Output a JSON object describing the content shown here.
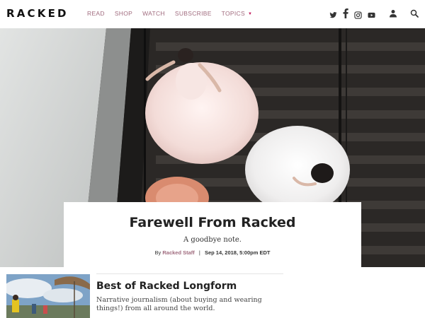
{
  "header": {
    "logo": "RACKED",
    "nav": [
      {
        "label": "READ"
      },
      {
        "label": "SHOP"
      },
      {
        "label": "WATCH"
      },
      {
        "label": "SUBSCRIBE"
      },
      {
        "label": "TOPICS"
      }
    ],
    "social_icons": [
      "twitter-icon",
      "facebook-icon",
      "instagram-icon",
      "youtube-icon"
    ],
    "utility_icons": [
      "user-icon",
      "search-icon"
    ]
  },
  "hero": {
    "image": "overhead-view-of-women-in-ball-gowns-on-stairs"
  },
  "feature": {
    "title": "Farewell From Racked",
    "dek": "A goodbye note.",
    "by": "By",
    "author": "Racked Staff",
    "separator": "|",
    "date": "Sep 14, 2018, 5:00pm EDT"
  },
  "teaser": {
    "image": "umbrella-beach-photo",
    "title": "Best of Racked Longform",
    "dek": "Narrative journalism (about buying and wearing things!) from all around the world."
  },
  "colors": {
    "accent": "#a06b7e",
    "caret": "#c2185b",
    "text": "#222222"
  }
}
